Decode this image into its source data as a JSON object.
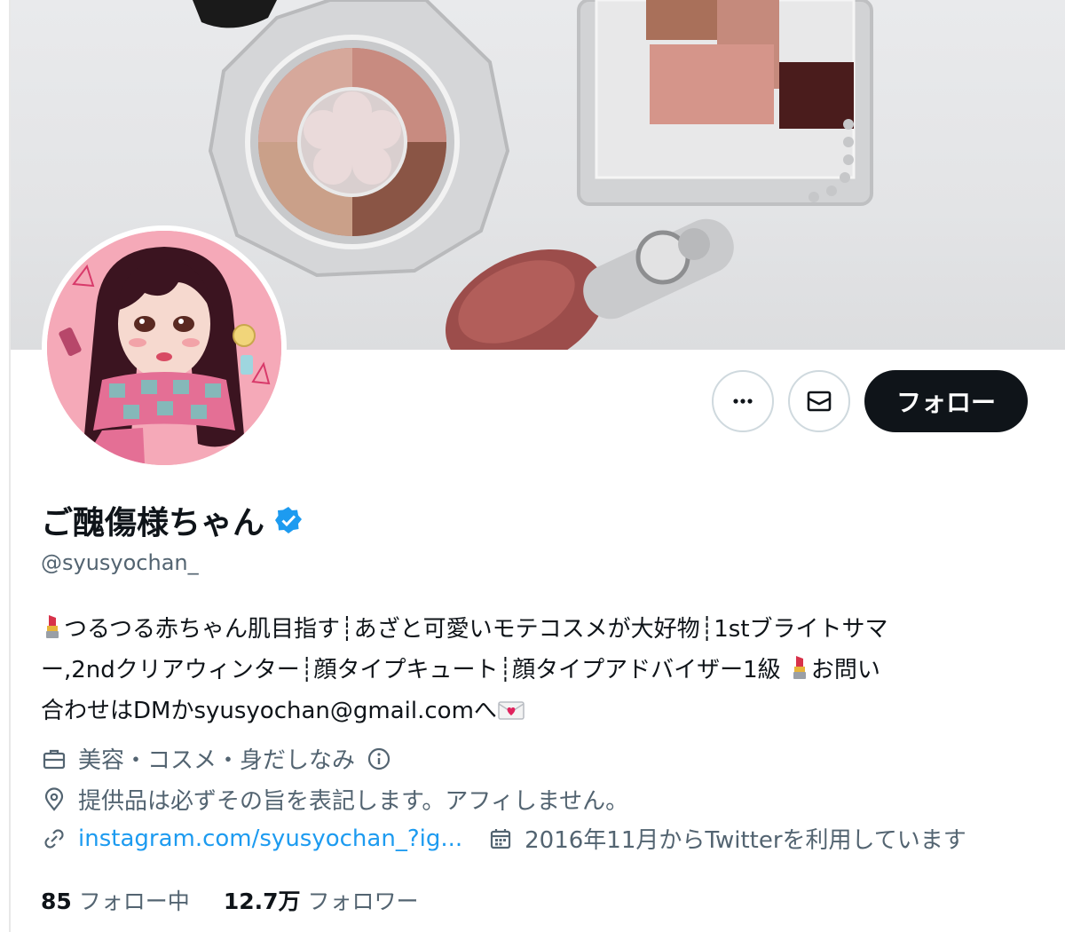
{
  "profile": {
    "display_name": "ご醜傷様ちゃん",
    "handle": "@syusyochan_",
    "verified": true,
    "bio": {
      "line1": "つるつる赤ちゃん肌目指す┊あざと可愛いモテコスメが大好物┊1stブライトサマ",
      "line2_a": "ー,2ndクリアウィンター┊顔タイプキュート┊顔タイプアドバイザー1級",
      "line2_b": "お問い",
      "line3": "合わせはDMかsyusyochan@gmail.comへ"
    },
    "category": "美容・コスメ・身だしなみ",
    "location": "提供品は必ずその旨を表記します。アフィしません。",
    "website": "instagram.com/syusyochan_?ig...",
    "joined": "2016年11月からTwitterを利用しています"
  },
  "actions": {
    "more_icon": "more-horizontal-icon",
    "message_icon": "envelope-icon",
    "follow_label": "フォロー"
  },
  "stats": {
    "following_count": "85",
    "following_label": "フォロー中",
    "followers_count": "12.7万",
    "followers_label": "フォロワー"
  },
  "colors": {
    "accent_blue": "#1d9bf0",
    "follow_button_bg": "#0f1419",
    "secondary_text": "#536471",
    "verified_badge": "#1d9bf0"
  }
}
